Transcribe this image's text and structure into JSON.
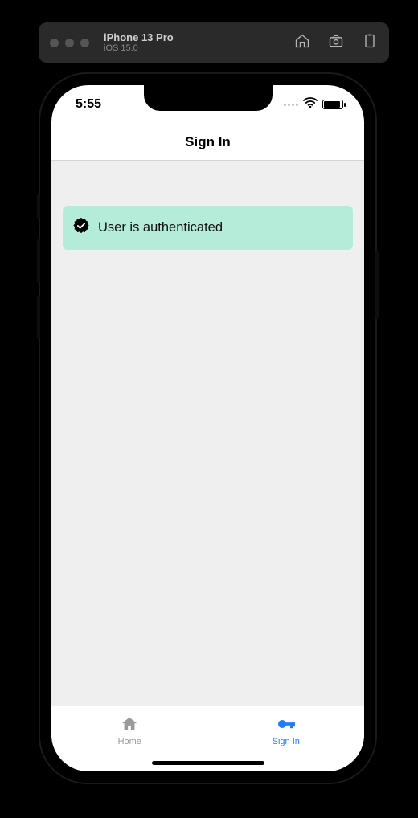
{
  "simulator": {
    "device": "iPhone 13 Pro",
    "os": "iOS 15.0"
  },
  "status_bar": {
    "time": "5:55"
  },
  "header": {
    "title": "Sign In"
  },
  "banner": {
    "message": "User is authenticated"
  },
  "tabs": {
    "home": {
      "label": "Home"
    },
    "signin": {
      "label": "Sign In"
    }
  },
  "colors": {
    "banner_bg": "#b5ecd9",
    "content_bg": "#efefef",
    "active_tint": "#1f7cff",
    "inactive_tint": "#9a9a9a"
  }
}
